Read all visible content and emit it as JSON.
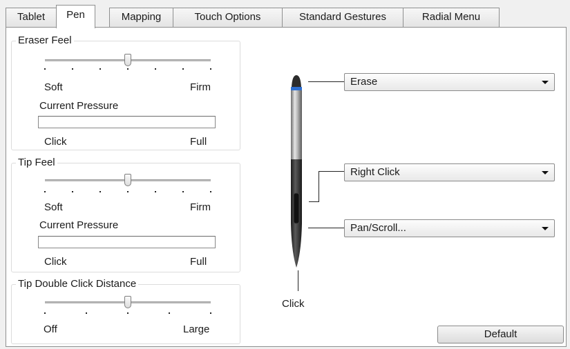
{
  "tabs": [
    {
      "label": "Tablet",
      "active": false
    },
    {
      "label": "Pen",
      "active": true
    },
    {
      "label": "Mapping",
      "active": false
    },
    {
      "label": "Touch Options",
      "active": false
    },
    {
      "label": "Standard Gestures",
      "active": false
    },
    {
      "label": "Radial Menu",
      "active": false
    }
  ],
  "eraser_feel": {
    "title": "Eraser Feel",
    "min_label": "Soft",
    "max_label": "Firm",
    "level": 0.5,
    "pressure_title": "Current Pressure",
    "pressure_min": "Click",
    "pressure_max": "Full"
  },
  "tip_feel": {
    "title": "Tip Feel",
    "min_label": "Soft",
    "max_label": "Firm",
    "level": 0.5,
    "pressure_title": "Current Pressure",
    "pressure_min": "Click",
    "pressure_max": "Full"
  },
  "double_click": {
    "title": "Tip Double Click Distance",
    "min_label": "Off",
    "max_label": "Large",
    "level": 0.5
  },
  "pen_buttons": {
    "eraser": "Erase",
    "upper_side": "Right Click",
    "lower_side": "Pan/Scroll...",
    "tip_label": "Click"
  },
  "default_button": "Default",
  "colors": {
    "pen_accent": "#2e6fd0"
  }
}
